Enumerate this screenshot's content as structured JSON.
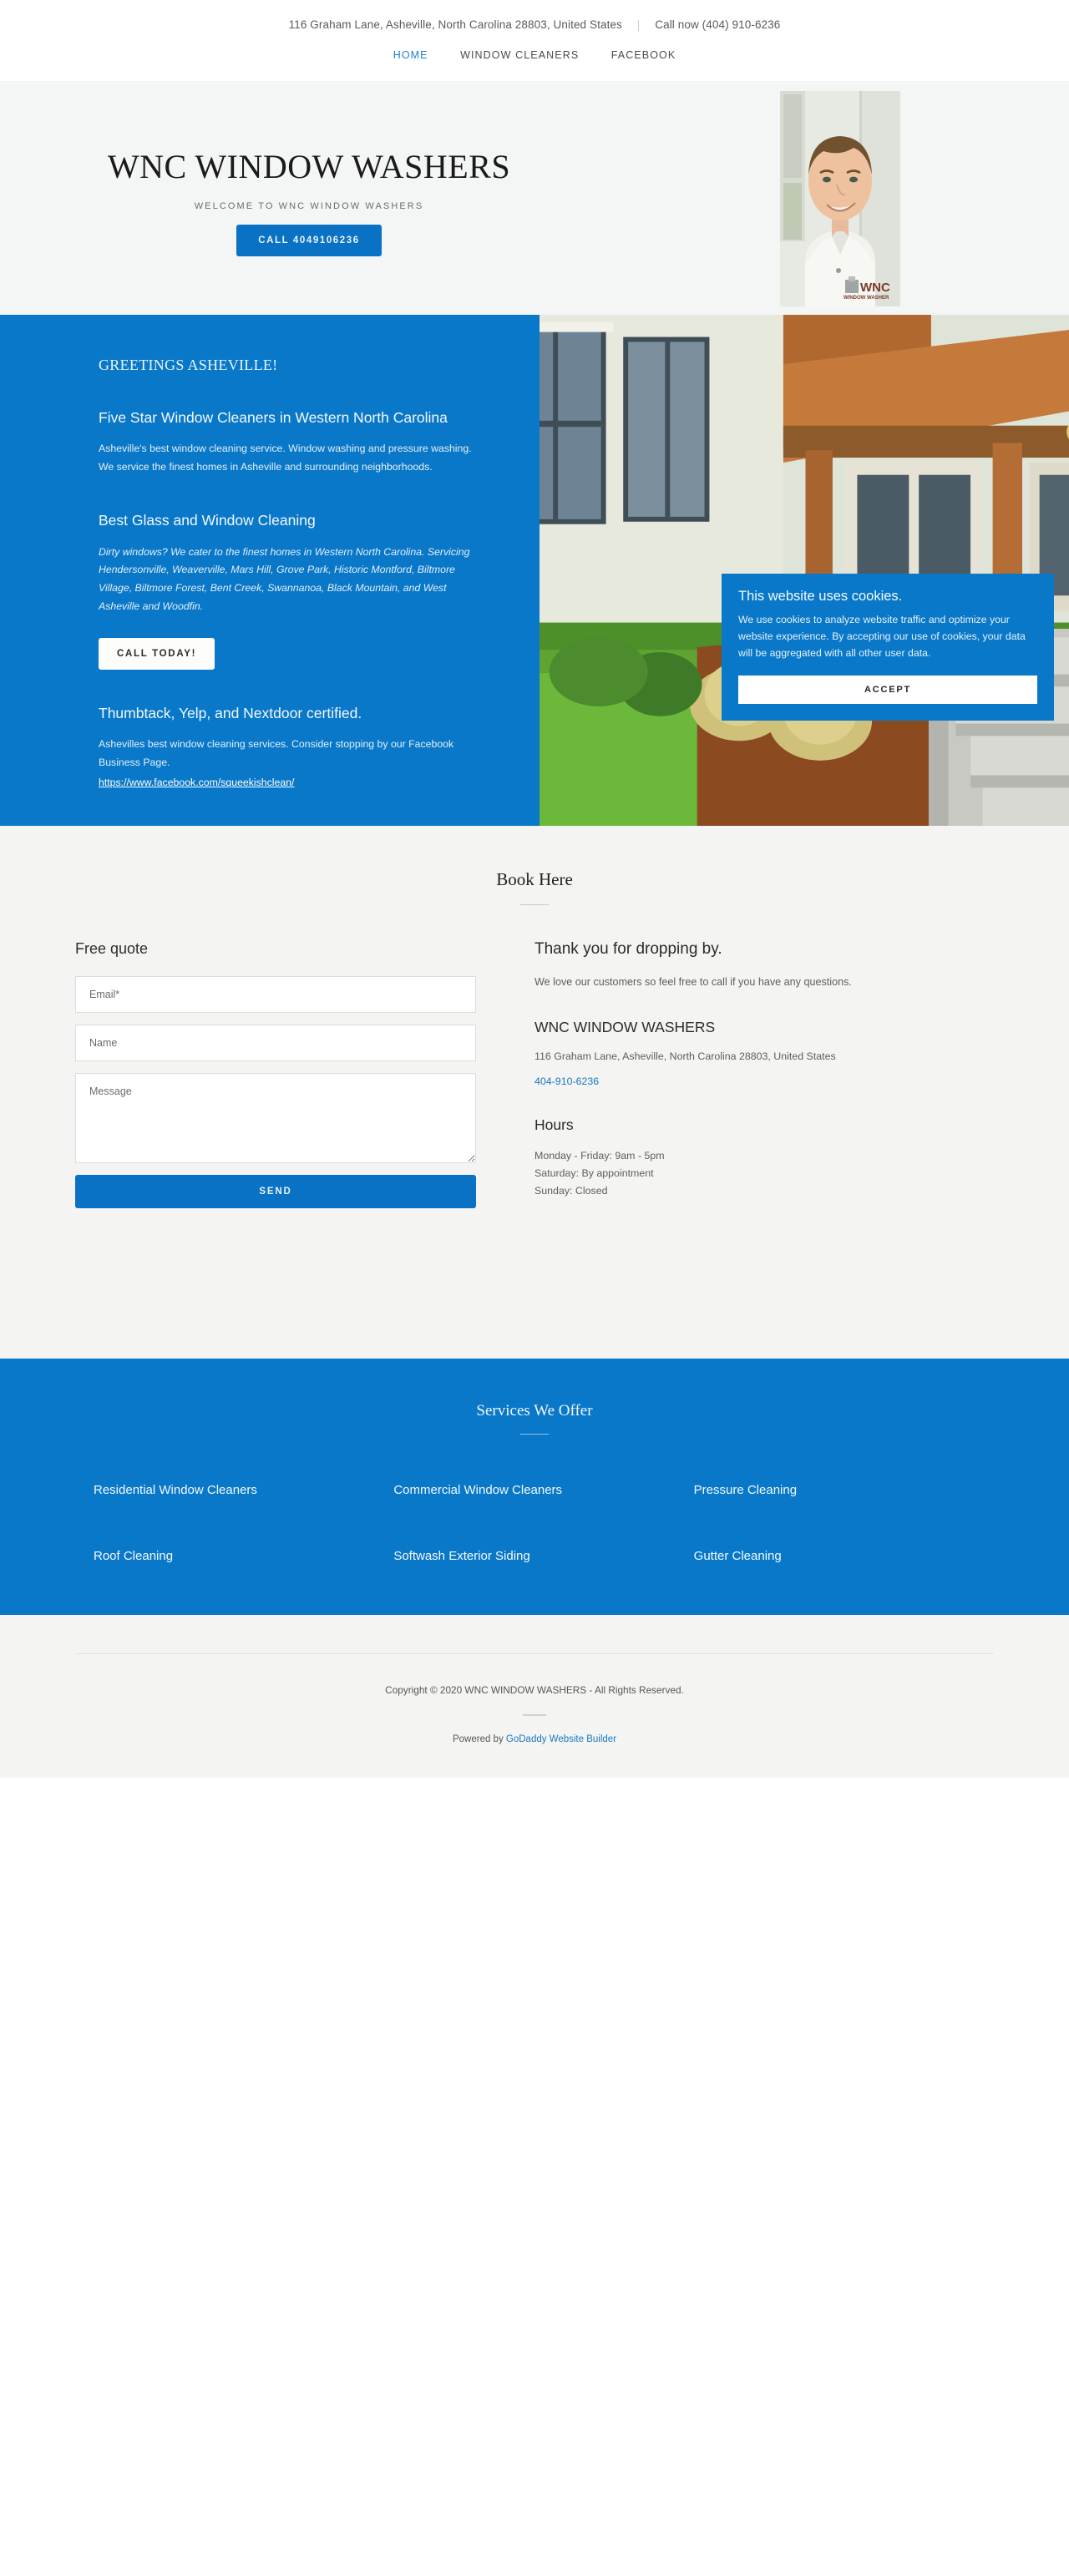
{
  "topbar": {
    "address": "116 Graham Lane, Asheville, North Carolina 28803, United States",
    "separator": "|",
    "call_now": "Call now (404) 910-6236"
  },
  "nav": {
    "items": [
      {
        "label": "HOME",
        "active": true
      },
      {
        "label": "WINDOW CLEANERS",
        "active": false
      },
      {
        "label": "FACEBOOK",
        "active": false
      }
    ]
  },
  "hero": {
    "title": "WNC WINDOW WASHERS",
    "subtitle": "WELCOME TO WNC WINDOW WASHERS",
    "cta_label": "CALL 4049106236",
    "photo_alt": "portrait-of-window-washer-in-wnc-polo-shirt"
  },
  "feature": {
    "greeting": "GREETINGS ASHEVILLE!",
    "heading_1": "Five Star Window Cleaners in Western North Carolina",
    "paragraph_1": "Asheville's best window cleaning service. Window washing and pressure washing. We service the finest homes in Asheville and surrounding neighborhoods.",
    "heading_2": "Best Glass and Window Cleaning",
    "paragraph_2": "Dirty windows? We cater to the finest homes in Western North Carolina. Servicing Hendersonville, Weaverville, Mars Hill, Grove Park, Historic Montford, Biltmore Village, Biltmore Forest, Bent Creek, Swannanoa, Black Mountain, and West Asheville and Woodfin.",
    "cta_label": "CALL TODAY!",
    "heading_3": "Thumbtack, Yelp, and Nextdoor certified.",
    "paragraph_3": "Ashevilles best window cleaning services. Consider stopping by our Facebook Business Page.",
    "facebook_link": "https://www.facebook.com/squeekishclean/",
    "image_alt": "house-exterior-with-windows-lawn-and-porch-steps"
  },
  "cookie": {
    "title": "This website uses cookies.",
    "body": "We use cookies to analyze website traffic and optimize your website experience. By accepting our use of cookies, your data will be aggregated with all other user data.",
    "accept_label": "ACCEPT"
  },
  "book": {
    "title": "Book Here",
    "form": {
      "heading": "Free quote",
      "email_placeholder": "Email*",
      "email_value": "",
      "name_placeholder": "Name",
      "name_value": "",
      "message_placeholder": "Message",
      "message_value": "",
      "send_label": "SEND"
    },
    "contact": {
      "heading": "Thank you for dropping by.",
      "paragraph": "We love our customers so feel free to call if you have any questions.",
      "business_name": "WNC WINDOW WASHERS",
      "address": "116 Graham Lane, Asheville, North Carolina 28803, United States",
      "phone": "404-910-6236",
      "hours_heading": "Hours",
      "hours": [
        "Monday - Friday: 9am - 5pm",
        "Saturday: By appointment",
        "Sunday: Closed"
      ]
    }
  },
  "services": {
    "title": "Services We Offer",
    "items": [
      "Residential Window Cleaners",
      "Commercial Window Cleaners",
      "Pressure Cleaning",
      "Roof Cleaning",
      "Softwash Exterior Siding",
      "Gutter Cleaning"
    ]
  },
  "footer": {
    "copyright": "Copyright © 2020 WNC WINDOW WASHERS - All Rights Reserved.",
    "powered_prefix": "Powered by ",
    "powered_link": "GoDaddy Website Builder"
  },
  "colors": {
    "brand_blue": "#0a78c8",
    "button_blue": "#0a72c4",
    "link_blue": "#1877c0",
    "page_grey": "#f4f5f3"
  }
}
